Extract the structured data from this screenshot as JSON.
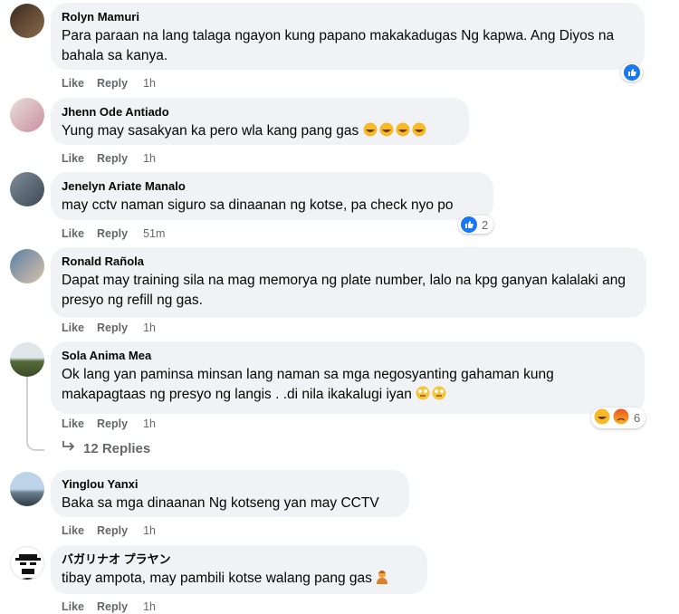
{
  "comments": [
    {
      "name": "Rolyn Mamuri",
      "text": "Para paraan na lang talaga ngayon kung papano makakadugas Ng kapwa. Ang Diyos na bahala sa kanya.",
      "like": "Like",
      "reply": "Reply",
      "time": "1h"
    },
    {
      "name": "Jhenn Ode Antiado",
      "text": "Yung may sasakyan ka pero wla kang pang gas",
      "like": "Like",
      "reply": "Reply",
      "time": "1h"
    },
    {
      "name": "Jenelyn Ariate Manalo",
      "text": "may cctv naman siguro sa dinaanan ng kotse, pa check nyo po",
      "like": "Like",
      "reply": "Reply",
      "time": "51m",
      "reaction_count": "2"
    },
    {
      "name": "Ronald Rañola",
      "text": "Dapat may training sila na mag memorya ng plate number, lalo na kpg ganyan kalalaki ang presyo ng refill ng gas.",
      "like": "Like",
      "reply": "Reply",
      "time": "1h"
    },
    {
      "name": "Sola Anima Mea",
      "text": "Ok lang yan paminsa minsan lang naman sa mga negosyanting gahaman kung makapagtaas ng presyo ng langis . .di nila ikakalugi iyan",
      "like": "Like",
      "reply": "Reply",
      "time": "1h",
      "reaction_count": "6"
    },
    {
      "name": "Yinglou Yanxi",
      "text": "Baka sa mga dinaanan Ng kotseng yan may CCTV",
      "like": "Like",
      "reply": "Reply",
      "time": "1h"
    },
    {
      "name": "バガリナオ プラヤン",
      "text": "tibay ampota, may pambili kotse walang pang gas",
      "like": "Like",
      "reply": "Reply",
      "time": "1h"
    }
  ],
  "replies_link": "12 Replies",
  "colors": {
    "bubble": "#f0f2f5",
    "meta": "#65676b",
    "like_blue": "#1877f2"
  }
}
